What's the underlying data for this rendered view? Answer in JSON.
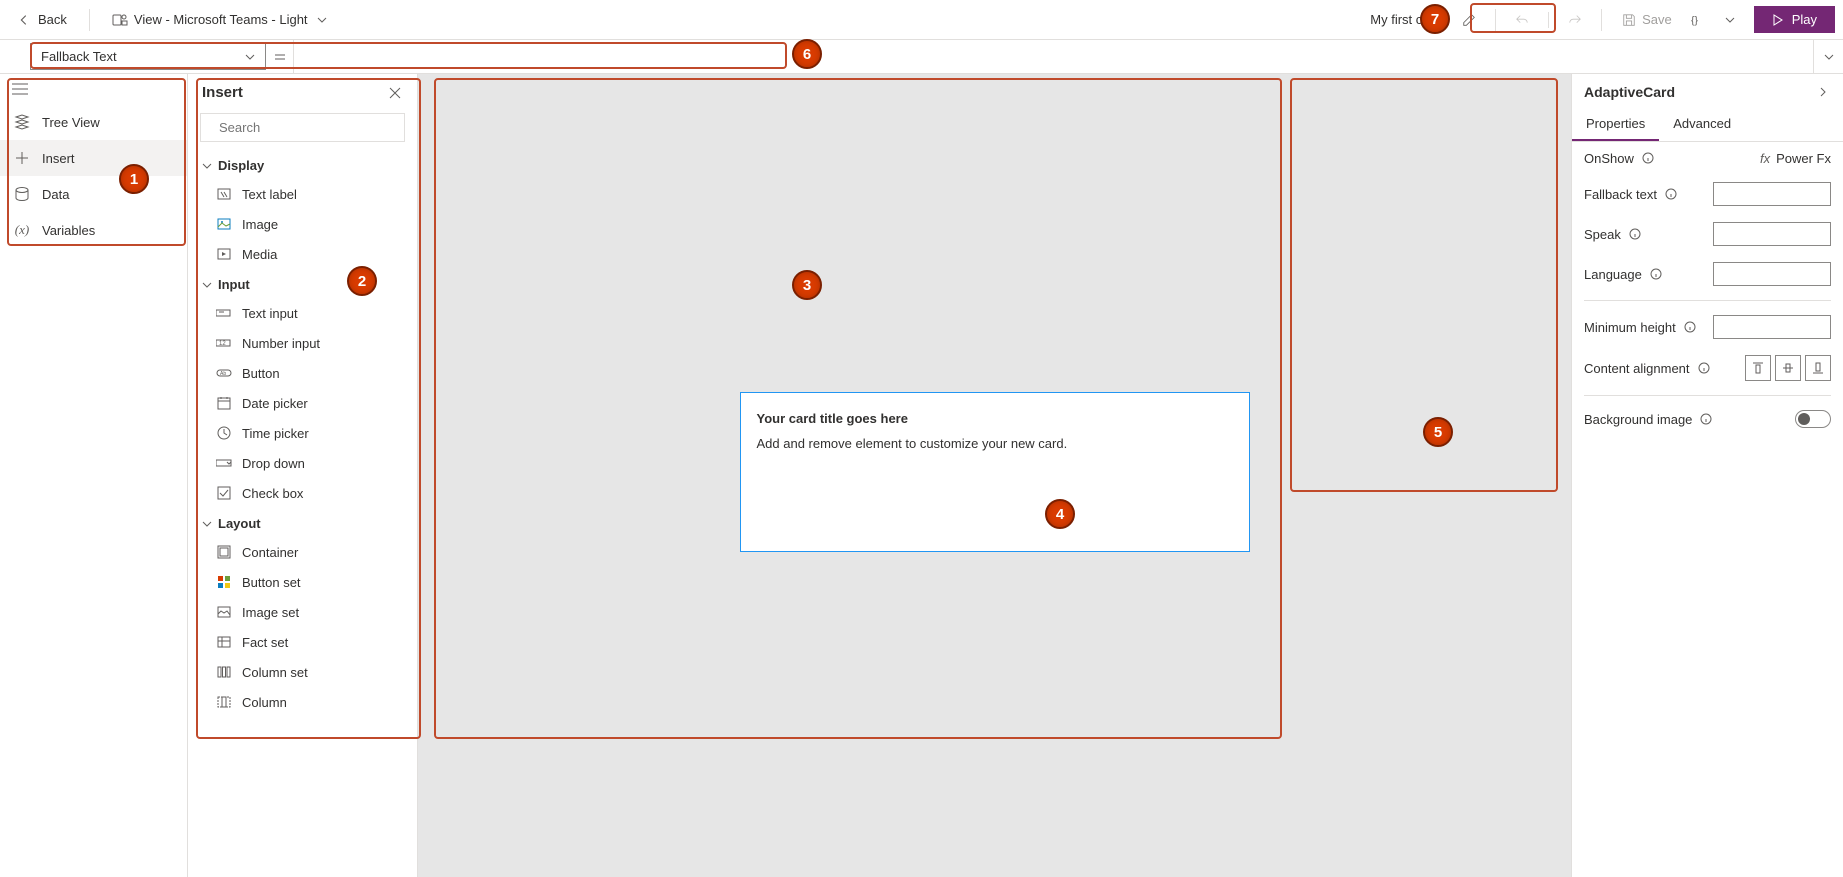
{
  "topbar": {
    "back_label": "Back",
    "view_label": "View - Microsoft Teams - Light",
    "card_name": "My first card",
    "save_label": "Save",
    "play_label": "Play"
  },
  "formula": {
    "prop": "Fallback Text",
    "value": ""
  },
  "nav": {
    "items": [
      "Tree View",
      "Insert",
      "Data",
      "Variables"
    ],
    "active": 1
  },
  "insert": {
    "title": "Insert",
    "search_placeholder": "Search",
    "groups": [
      {
        "name": "Display",
        "items": [
          "Text label",
          "Image",
          "Media"
        ]
      },
      {
        "name": "Input",
        "items": [
          "Text input",
          "Number input",
          "Button",
          "Date picker",
          "Time picker",
          "Drop down",
          "Check box"
        ]
      },
      {
        "name": "Layout",
        "items": [
          "Container",
          "Button set",
          "Image set",
          "Fact set",
          "Column set",
          "Column"
        ]
      }
    ]
  },
  "canvas": {
    "card_title": "Your card title goes here",
    "card_body": "Add and remove element to customize your new card."
  },
  "prop_panel": {
    "title": "AdaptiveCard",
    "tabs": [
      "Properties",
      "Advanced"
    ],
    "active_tab": 0,
    "onshow_label": "OnShow",
    "powerfx_label": "Power Fx",
    "rows": [
      "Fallback text",
      "Speak",
      "Language",
      "Minimum height"
    ],
    "content_alignment": "Content alignment",
    "background_image": "Background image"
  },
  "annotations": [
    "1",
    "2",
    "3",
    "4",
    "5",
    "6",
    "7"
  ]
}
